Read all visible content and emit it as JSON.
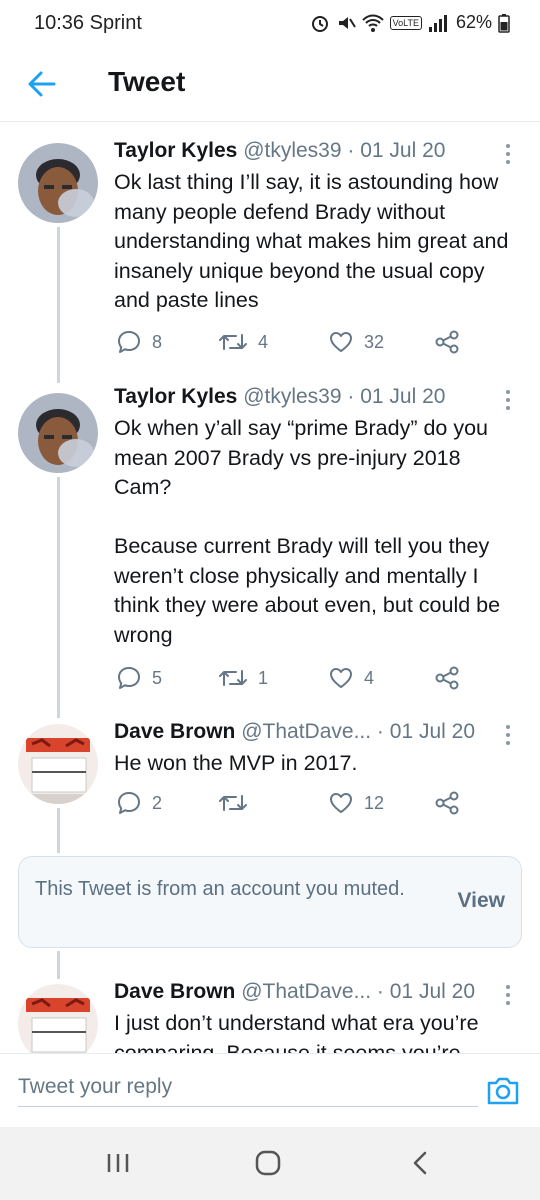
{
  "status_bar": {
    "time": "10:36",
    "carrier": "Sprint",
    "battery": "62%",
    "network": "VoLTE"
  },
  "header": {
    "title": "Tweet",
    "back_icon": "arrow-left-icon"
  },
  "tweets": [
    {
      "name": "Taylor Kyles",
      "handle": "@tkyles39",
      "separator": " · ",
      "date": "01 Jul 20",
      "text": "Ok last thing I’ll say, it is astounding how many people defend Brady without understanding what makes him great and insanely unique beyond the usual copy and paste lines",
      "replies": "8",
      "retweets": "4",
      "likes": "32"
    },
    {
      "name": "Taylor Kyles",
      "handle": "@tkyles39",
      "separator": " · ",
      "date": "01 Jul 20",
      "text": "Ok when y’all say “prime Brady” do you mean 2007 Brady vs pre-injury 2018 Cam?\n\nBecause current Brady will tell you they weren’t close physically and mentally I think they were about even, but could be wrong",
      "replies": "5",
      "retweets": "1",
      "likes": "4"
    },
    {
      "name": "Dave Brown",
      "handle": "@ThatDave...",
      "separator": " · ",
      "date": "01 Jul 20",
      "text": "He won the MVP in 2017.",
      "replies": "2",
      "retweets": "",
      "likes": "12"
    },
    {
      "name": "Dave Brown",
      "handle": "@ThatDave...",
      "separator": " · ",
      "date": "01 Jul 20",
      "text": "I just don’t understand what era you’re comparing. Because it seems you’re"
    }
  ],
  "muted_notice": {
    "text": "This Tweet is from an account you muted.",
    "action": "View"
  },
  "reply": {
    "placeholder": "Tweet your reply"
  },
  "colors": {
    "accent": "#1da1f2",
    "text_primary": "#14171a",
    "text_secondary": "#657786",
    "thread_line": "#ccd6dd"
  }
}
